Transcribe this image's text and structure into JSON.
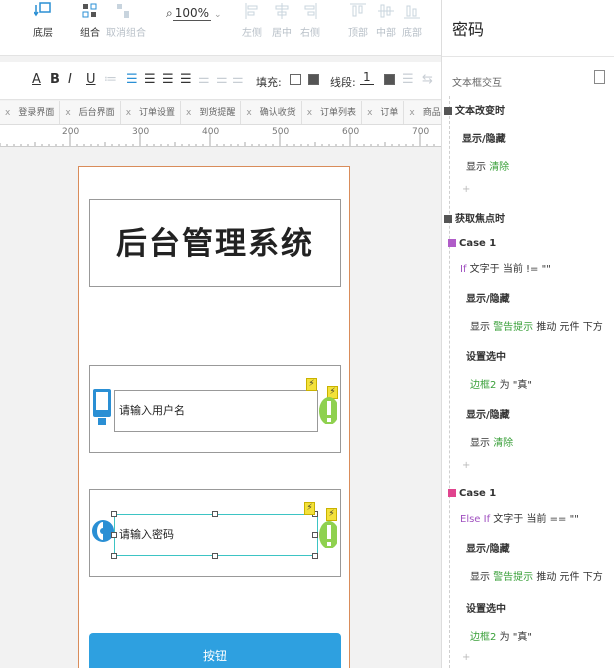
{
  "toolbar": {
    "bottom_layer": "底层",
    "group": "组合",
    "ungroup": "取消组合",
    "zoom": "100%",
    "align_left": "左侧",
    "align_center": "居中",
    "align_right": "右侧",
    "align_top": "顶部",
    "align_middle": "中部",
    "align_bottom": "底部"
  },
  "format_bar": {
    "fill_label": "填充:",
    "line_label": "线段:",
    "line_width": "1"
  },
  "tabs": [
    "登录界面",
    "后台界面",
    "订单设置",
    "到货提醒",
    "确认收货",
    "订单列表",
    "订单",
    "商品目录"
  ],
  "ruler": [
    "200",
    "300",
    "400",
    "500",
    "600",
    "700"
  ],
  "canvas": {
    "title": "后台管理系统",
    "username_placeholder": "请输入用户名",
    "password_placeholder": "请输入密码",
    "button_label": "按钮"
  },
  "panel": {
    "title": "密码",
    "subtitle": "文本框交互",
    "event1": "文本改变时",
    "e1_action": "显示/隐藏",
    "e1_show": "显示",
    "e1_target": "清除",
    "event2": "获取焦点时",
    "case1": "Case 1",
    "case1_if": "If",
    "case1_cond": "文字于 当前 != \"\"",
    "c1_action1": "显示/隐藏",
    "c1_show": "显示",
    "c1_target": "警告提示",
    "c1_suffix": "推动 元件 下方",
    "c1_action2": "设置选中",
    "c1_sel_target": "边框2",
    "c1_sel_suffix": "为 \"真\"",
    "c1_action3": "显示/隐藏",
    "c1_show2": "显示",
    "c1_target2": "清除",
    "case2": "Case 1",
    "case2_if": "Else If",
    "case2_cond": "文字于 当前 == \"\"",
    "c2_action1": "显示/隐藏",
    "c2_show": "显示",
    "c2_target": "警告提示",
    "c2_suffix": "推动 元件 下方",
    "c2_action2": "设置选中",
    "c2_sel_target": "边框2",
    "c2_sel_suffix": "为 \"真\""
  },
  "colors": {
    "accent_green": "#3aa03a",
    "button_blue": "#2ea0e0",
    "page_border": "#d98c5a",
    "selection_cyan": "#3dc4c4"
  }
}
